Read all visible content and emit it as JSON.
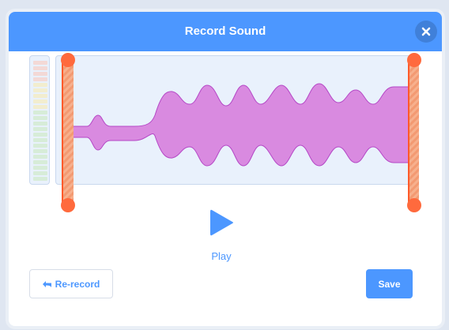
{
  "modal": {
    "title": "Record Sound",
    "close_icon": "close-icon"
  },
  "recorder": {
    "play_label": "Play",
    "play_icon": "play-triangle-icon",
    "trim_start": 0.0,
    "trim_end": 1.0
  },
  "footer": {
    "rerecord_label": "Re-record",
    "rerecord_icon": "undo-arrow-icon",
    "save_label": "Save"
  },
  "colors": {
    "accent": "#4c97ff",
    "waveform_fill": "#d98ae0",
    "waveform_stroke": "#b548c6",
    "trim_handle": "#ff6a3d",
    "panel_bg": "#e9f1fc"
  }
}
